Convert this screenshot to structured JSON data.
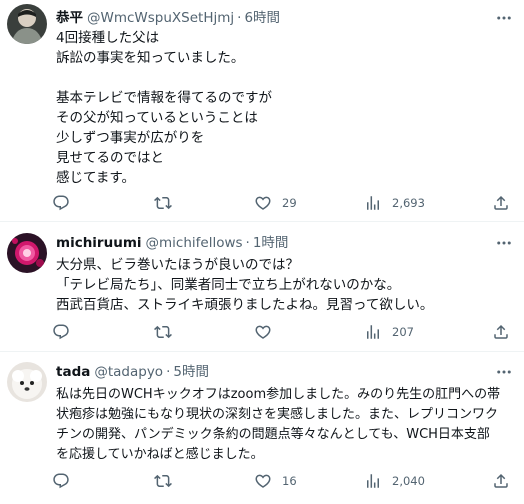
{
  "tweets": [
    {
      "name": "恭平",
      "handle": "@WmcWspuXSetHjmj",
      "time": "6時間",
      "lines": [
        "4回接種した父は",
        "訴訟の事実を知っていました。",
        "",
        "基本テレビで情報を得てるのですが",
        "その父が知っているということは",
        "少しずつ事実が広がりを",
        "見せてるのではと",
        "感じてます。"
      ],
      "replies": "",
      "retweets": "",
      "likes": "29",
      "views": "2,693"
    },
    {
      "name": "michiruumi",
      "handle": "@michifellows",
      "time": "1時間",
      "lines": [
        "大分県、ビラ巻いたほうが良いのでは？",
        "「テレビ局たち」、同業者同士で立ち上がれないのかな。",
        "西武百貨店、ストライキ頑張りましたよね。見習って欲しい。"
      ],
      "replies": "",
      "retweets": "",
      "likes": "",
      "views": "207"
    },
    {
      "name": "tada",
      "handle": "@tadapyo",
      "time": "5時間",
      "lines": [
        "私は先日のWCHキックオフはzoom参加しました。みのり先生の肛門への帯",
        "状疱疹は勉強にもなり現状の深刻さを実感しました。また、レプリコンワク",
        "チンの開発、パンデミック条約の問題点等々なんとしても、WCH日本支部",
        "を応援していかねばと感じました。"
      ],
      "replies": "",
      "retweets": "",
      "likes": "16",
      "views": "2,040"
    }
  ],
  "icons": {
    "reply": "reply-icon",
    "retweet": "retweet-icon",
    "like": "heart-icon",
    "views": "views-icon",
    "share": "share-icon",
    "more": "more-icon"
  },
  "colors": {
    "text": "#0f1419",
    "secondary": "#536471",
    "divider": "#eff3f4"
  }
}
